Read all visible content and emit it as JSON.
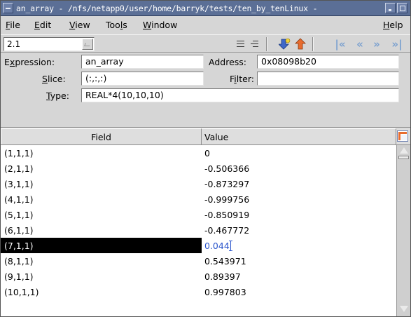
{
  "window": {
    "title": "an_array - /nfs/netapp0/user/home/barryk/tests/ten_by_tenLinux -"
  },
  "menu": {
    "items": [
      {
        "pre": "",
        "u": "F",
        "post": "ile"
      },
      {
        "pre": "",
        "u": "E",
        "post": "dit"
      },
      {
        "pre": "",
        "u": "V",
        "post": "iew"
      },
      {
        "pre": "Too",
        "u": "l",
        "post": "s"
      },
      {
        "pre": "",
        "u": "W",
        "post": "indow"
      },
      {
        "pre": "",
        "u": "H",
        "post": "elp"
      }
    ]
  },
  "toolbar": {
    "thread_value": "2.1",
    "icons": [
      "lines-icon",
      "lines-icon",
      "dive-icon",
      "undive-icon",
      "first-icon",
      "previous-icon",
      "next-icon",
      "last-icon"
    ]
  },
  "fields": {
    "expression_label": {
      "pre": "E",
      "u": "x",
      "post": "pression:"
    },
    "expression_value": "an_array",
    "address_label": "Address:",
    "address_value": "0x08098b20",
    "slice_label": {
      "pre": "",
      "u": "S",
      "post": "lice:"
    },
    "slice_value": "(:,:,:)",
    "filter_label": {
      "pre": "F",
      "u": "i",
      "post": "lter:"
    },
    "filter_value": "",
    "type_label": {
      "pre": "",
      "u": "T",
      "post": "ype:"
    },
    "type_value": "REAL*4(10,10,10)"
  },
  "table": {
    "headers": {
      "field": "Field",
      "value": "Value"
    },
    "rows": [
      {
        "field": "(1,1,1)",
        "value": "0"
      },
      {
        "field": "(2,1,1)",
        "value": "-0.506366"
      },
      {
        "field": "(3,1,1)",
        "value": "-0.873297"
      },
      {
        "field": "(4,1,1)",
        "value": "-0.999756"
      },
      {
        "field": "(5,1,1)",
        "value": "-0.850919"
      },
      {
        "field": "(6,1,1)",
        "value": "-0.467772"
      },
      {
        "field": "(7,1,1)",
        "value": "0.044",
        "selected": true
      },
      {
        "field": "(8,1,1)",
        "value": "0.543971"
      },
      {
        "field": "(9,1,1)",
        "value": "0.89397"
      },
      {
        "field": "(10,1,1)",
        "value": "0.997803"
      }
    ]
  },
  "colors": {
    "titlebar": "#5b6f96",
    "selection": "#000000",
    "edit_text": "#2a55cc"
  }
}
